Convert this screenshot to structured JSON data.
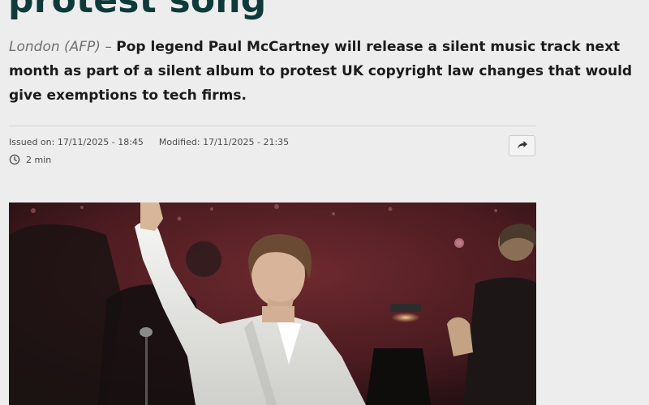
{
  "article": {
    "headline_fragment": "protest song",
    "dateline": "London (AFP)",
    "dash": " – ",
    "lead": "Pop legend Paul McCartney will release a silent music track next month as part of a silent album to protest UK copyright law changes that would give exemptions to tech firms.",
    "issued_label": "Issued on:",
    "issued_value": "17/11/2025 - 18:45",
    "modified_label": "Modified:",
    "modified_value": "17/11/2025 - 21:35",
    "read_time": "2 min"
  },
  "icons": {
    "clock": "clock-icon",
    "share": "share-arrow-icon"
  },
  "colors": {
    "headline": "#0f3a3a",
    "background": "#ededed",
    "photo_backdrop": "#5a1f24"
  }
}
